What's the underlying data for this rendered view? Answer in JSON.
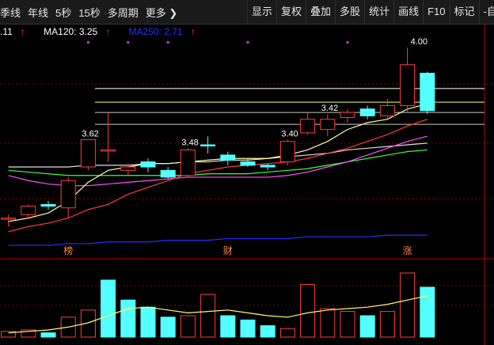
{
  "toolbar": {
    "period_items": [
      "季线",
      "年线",
      "5秒",
      "15秒",
      "多周期",
      "更多 ❯"
    ],
    "buttons": [
      "显示",
      "复权",
      "叠加",
      "多股",
      "统计",
      "画线",
      "F10",
      "标记",
      "-自选"
    ]
  },
  "indicators": {
    "ma_partial": {
      "label": ".11",
      "arrow": "↑",
      "color": "#ffffff"
    },
    "ma120": {
      "label": "MA120: 3.25",
      "arrow": "↑",
      "color": "#ffffff",
      "arrow_color": "#ff3b3b"
    },
    "ma250": {
      "label": "MA250: 2.71",
      "arrow": "↑",
      "color": "#2b2bff",
      "arrow_color": "#ff3b3b"
    }
  },
  "markers": {
    "bang": "榜",
    "cai": "财",
    "zhang": "涨"
  },
  "colors": {
    "up": "#ff3b3b",
    "down": "#54ffff",
    "ma5": "#ffffa0",
    "ma10": "#ff3b3b",
    "ma20": "#ff4fff",
    "ma30": "#3cff3c",
    "ma60": "#dcdcdc",
    "ma120": "#ffffff",
    "ma250": "#2b2bff",
    "grid": "#8b0000",
    "volma": "#ffff66",
    "label": "#ffffff",
    "marker": "#ff8a3d",
    "dot": "#cc33cc"
  },
  "chart_data": {
    "type": "candlestick",
    "price_labels": [
      {
        "text": "3.62",
        "candle": 4
      },
      {
        "text": "3.48",
        "candle": 9
      },
      {
        "text": "3.40",
        "candle": 14
      },
      {
        "text": "3.42",
        "candle": 16
      },
      {
        "text": "4.00",
        "candle": 20
      }
    ],
    "candles": [
      {
        "o": 3.0,
        "c": 3.0,
        "h": 3.02,
        "l": 2.95,
        "up": true
      },
      {
        "o": 3.02,
        "c": 3.07,
        "h": 3.08,
        "l": 3.0,
        "up": true
      },
      {
        "o": 3.08,
        "c": 3.07,
        "h": 3.1,
        "l": 3.05,
        "up": false
      },
      {
        "o": 3.06,
        "c": 3.22,
        "h": 3.24,
        "l": 3.0,
        "up": true
      },
      {
        "o": 3.3,
        "c": 3.46,
        "h": 3.46,
        "l": 3.28,
        "up": true
      },
      {
        "o": 3.4,
        "c": 3.4,
        "h": 3.62,
        "l": 3.33,
        "up": true
      },
      {
        "o": 3.28,
        "c": 3.3,
        "h": 3.32,
        "l": 3.25,
        "up": true
      },
      {
        "o": 3.33,
        "c": 3.3,
        "h": 3.35,
        "l": 3.27,
        "up": false
      },
      {
        "o": 3.28,
        "c": 3.24,
        "h": 3.3,
        "l": 3.23,
        "up": false
      },
      {
        "o": 3.25,
        "c": 3.4,
        "h": 3.41,
        "l": 3.24,
        "up": true
      },
      {
        "o": 3.43,
        "c": 3.43,
        "h": 3.48,
        "l": 3.38,
        "up": false
      },
      {
        "o": 3.37,
        "c": 3.34,
        "h": 3.39,
        "l": 3.31,
        "up": false
      },
      {
        "o": 3.33,
        "c": 3.31,
        "h": 3.35,
        "l": 3.3,
        "up": false
      },
      {
        "o": 3.31,
        "c": 3.3,
        "h": 3.32,
        "l": 3.28,
        "up": false
      },
      {
        "o": 3.33,
        "c": 3.45,
        "h": 3.46,
        "l": 3.31,
        "up": true
      },
      {
        "o": 3.5,
        "c": 3.58,
        "h": 3.62,
        "l": 3.49,
        "up": true
      },
      {
        "o": 3.52,
        "c": 3.58,
        "h": 3.61,
        "l": 3.48,
        "up": true
      },
      {
        "o": 3.59,
        "c": 3.62,
        "h": 3.64,
        "l": 3.56,
        "up": true
      },
      {
        "o": 3.64,
        "c": 3.6,
        "h": 3.66,
        "l": 3.58,
        "up": false
      },
      {
        "o": 3.6,
        "c": 3.66,
        "h": 3.7,
        "l": 3.58,
        "up": true
      },
      {
        "o": 3.66,
        "c": 3.9,
        "h": 4.0,
        "l": 3.62,
        "up": true
      },
      {
        "o": 3.85,
        "c": 3.63,
        "h": 3.86,
        "l": 3.61,
        "up": false
      }
    ],
    "volumes": [
      {
        "v": 8,
        "up": true
      },
      {
        "v": 10,
        "up": true
      },
      {
        "v": 6,
        "up": false
      },
      {
        "v": 28,
        "up": true
      },
      {
        "v": 38,
        "up": true
      },
      {
        "v": 80,
        "up": false
      },
      {
        "v": 52,
        "up": false
      },
      {
        "v": 42,
        "up": false
      },
      {
        "v": 28,
        "up": false
      },
      {
        "v": 30,
        "up": true
      },
      {
        "v": 60,
        "up": true
      },
      {
        "v": 30,
        "up": false
      },
      {
        "v": 24,
        "up": false
      },
      {
        "v": 16,
        "up": false
      },
      {
        "v": 12,
        "up": true
      },
      {
        "v": 74,
        "up": true
      },
      {
        "v": 40,
        "up": true
      },
      {
        "v": 36,
        "up": true
      },
      {
        "v": 30,
        "up": false
      },
      {
        "v": 36,
        "up": true
      },
      {
        "v": 90,
        "up": true
      },
      {
        "v": 70,
        "up": false
      }
    ],
    "ma5": [
      2.98,
      3.0,
      3.03,
      3.1,
      3.21,
      3.28,
      3.3,
      3.32,
      3.32,
      3.33,
      3.34,
      3.35,
      3.35,
      3.35,
      3.37,
      3.4,
      3.45,
      3.52,
      3.56,
      3.58,
      3.64,
      3.67
    ],
    "ma10": [
      2.92,
      2.95,
      2.97,
      3.0,
      3.05,
      3.08,
      3.14,
      3.18,
      3.22,
      3.26,
      3.28,
      3.3,
      3.31,
      3.32,
      3.33,
      3.35,
      3.38,
      3.41,
      3.45,
      3.49,
      3.54,
      3.58
    ],
    "ma20": [
      3.25,
      3.22,
      3.2,
      3.19,
      3.19,
      3.2,
      3.21,
      3.22,
      3.23,
      3.24,
      3.24,
      3.24,
      3.24,
      3.24,
      3.25,
      3.27,
      3.3,
      3.33,
      3.37,
      3.41,
      3.45,
      3.48
    ],
    "ma30": [
      3.28,
      3.27,
      3.26,
      3.25,
      3.25,
      3.25,
      3.25,
      3.25,
      3.25,
      3.25,
      3.26,
      3.26,
      3.26,
      3.27,
      3.28,
      3.29,
      3.31,
      3.33,
      3.35,
      3.37,
      3.39,
      3.4
    ],
    "ma60": [
      3.3,
      3.3,
      3.3,
      3.3,
      3.31,
      3.31,
      3.31,
      3.32,
      3.32,
      3.33,
      3.33,
      3.34,
      3.34,
      3.35,
      3.36,
      3.37,
      3.38,
      3.4,
      3.41,
      3.42,
      3.43,
      3.44
    ],
    "ma250": [
      2.84,
      2.84,
      2.84,
      2.85,
      2.85,
      2.86,
      2.86,
      2.86,
      2.87,
      2.87,
      2.87,
      2.88,
      2.88,
      2.88,
      2.88,
      2.89,
      2.89,
      2.89,
      2.89,
      2.9,
      2.9,
      2.9
    ],
    "vol_ma": [
      6,
      8,
      10,
      14,
      20,
      30,
      40,
      42,
      38,
      34,
      36,
      38,
      34,
      30,
      28,
      34,
      38,
      40,
      42,
      46,
      52,
      58
    ],
    "ref_lines": [
      3.76,
      3.68,
      3.62,
      3.55
    ],
    "marker_candles": {
      "bang": 3,
      "cai": 11,
      "zhang": 20
    },
    "dot_candles": [
      4,
      6,
      8,
      12,
      17
    ]
  }
}
